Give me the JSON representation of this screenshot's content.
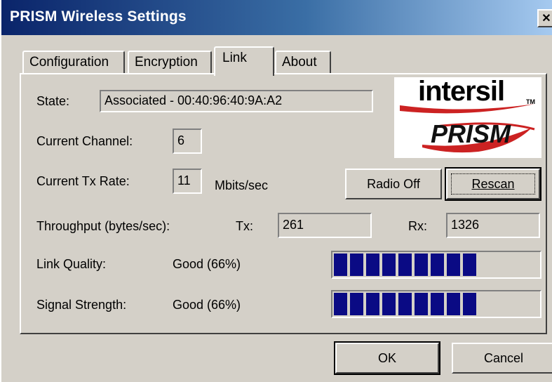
{
  "window": {
    "title": "PRISM Wireless Settings",
    "close_glyph": "✕"
  },
  "tabs": [
    {
      "label": "Configuration",
      "active": false
    },
    {
      "label": "Encryption",
      "active": false
    },
    {
      "label": "Link",
      "active": true
    },
    {
      "label": "About",
      "active": false
    }
  ],
  "link": {
    "state_label": "State:",
    "state_value": "Associated - 00:40:96:40:9A:A2",
    "channel_label": "Current Channel:",
    "channel_value": "6",
    "txrate_label": "Current Tx Rate:",
    "txrate_value": "11",
    "txrate_unit": "Mbits/sec",
    "throughput_label": "Throughput (bytes/sec):",
    "tx_label": "Tx:",
    "tx_value": "261",
    "rx_label": "Rx:",
    "rx_value": "1326",
    "link_quality_label": "Link Quality:",
    "link_quality_value": "Good (66%)",
    "link_quality_percent": 66,
    "signal_label": "Signal Strength:",
    "signal_value": "Good (66%)",
    "signal_percent": 66,
    "radio_off_label": "Radio Off",
    "rescan_label": "Rescan",
    "rescan_mnemonic": "R"
  },
  "logo": {
    "brand": "intersil",
    "product": "PRISM",
    "accent_color": "#cc2222"
  },
  "footer": {
    "ok_label": "OK",
    "cancel_label": "Cancel"
  },
  "colors": {
    "titlebar_start": "#0a246a",
    "titlebar_end": "#a6caf0",
    "progress_fill": "#0a0a84",
    "face": "#d4d0c8"
  }
}
